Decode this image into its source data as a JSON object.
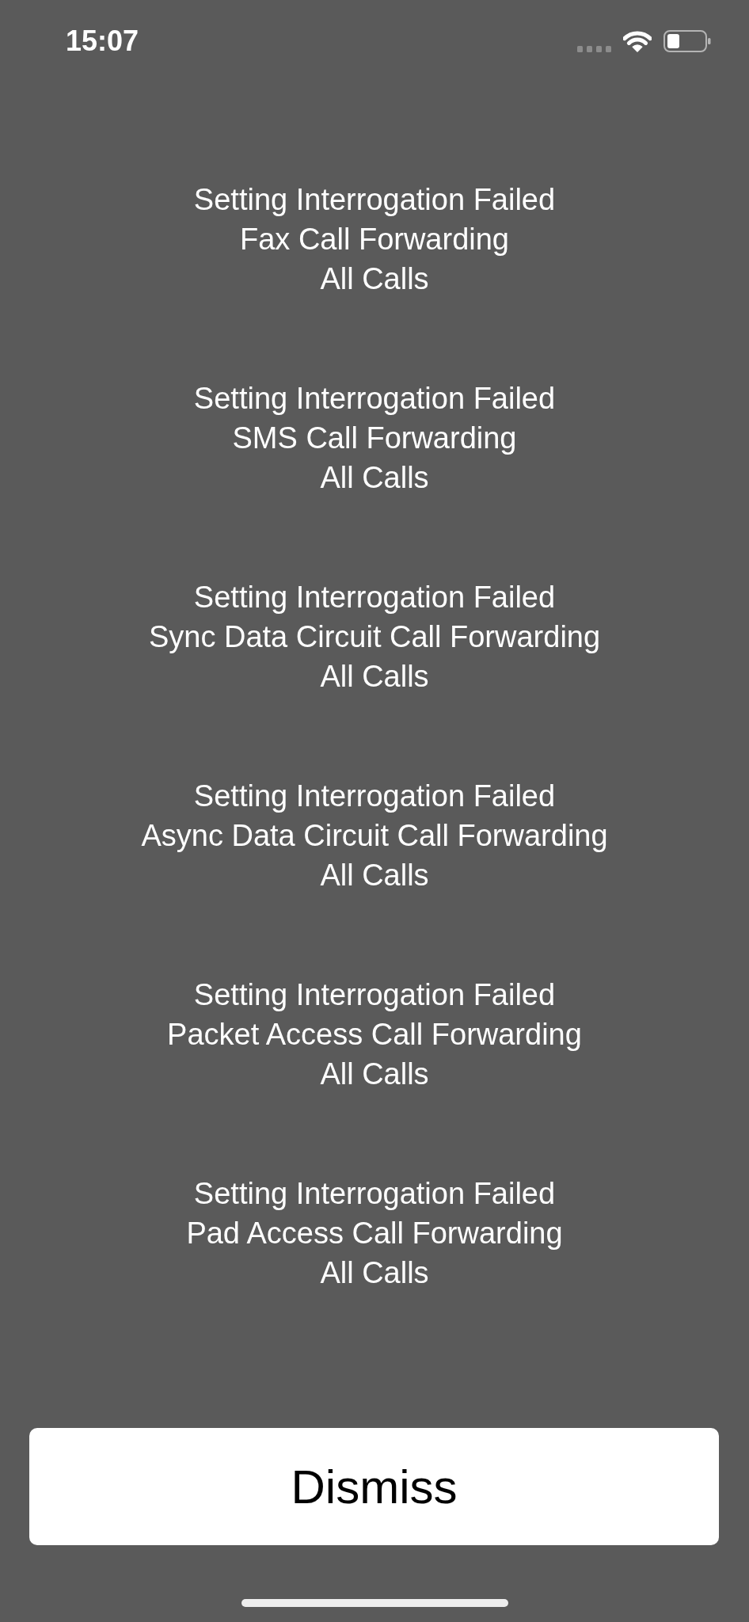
{
  "status_bar": {
    "time": "15:07"
  },
  "messages": [
    {
      "title": "Setting Interrogation Failed",
      "service": "Fax Call Forwarding",
      "condition": "All Calls"
    },
    {
      "title": "Setting Interrogation Failed",
      "service": "SMS Call Forwarding",
      "condition": "All Calls"
    },
    {
      "title": "Setting Interrogation Failed",
      "service": "Sync Data Circuit Call Forwarding",
      "condition": "All Calls"
    },
    {
      "title": "Setting Interrogation Failed",
      "service": "Async Data Circuit Call Forwarding",
      "condition": "All Calls"
    },
    {
      "title": "Setting Interrogation Failed",
      "service": "Packet Access Call Forwarding",
      "condition": "All Calls"
    },
    {
      "title": "Setting Interrogation Failed",
      "service": "Pad Access Call Forwarding",
      "condition": "All Calls"
    }
  ],
  "dismiss_button": {
    "label": "Dismiss"
  }
}
